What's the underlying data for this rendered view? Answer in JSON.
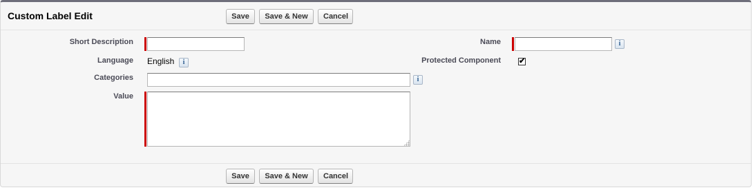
{
  "header": {
    "title": "Custom Label Edit",
    "buttons": {
      "save": "Save",
      "save_new": "Save & New",
      "cancel": "Cancel"
    }
  },
  "form": {
    "short_description": {
      "label": "Short Description",
      "value": "",
      "required": true
    },
    "name": {
      "label": "Name",
      "value": "",
      "required": true
    },
    "language": {
      "label": "Language",
      "value": "English"
    },
    "protected_component": {
      "label": "Protected Component",
      "checked": true,
      "check_glyph": "✔"
    },
    "categories": {
      "label": "Categories",
      "value": ""
    },
    "value": {
      "label": "Value",
      "value": "",
      "required": true
    },
    "info_glyph": "i"
  },
  "footer": {
    "buttons": {
      "save": "Save",
      "save_new": "Save & New",
      "cancel": "Cancel"
    }
  },
  "colors": {
    "required_bar": "#cc0000",
    "label_text": "#4a4a56",
    "header_border": "#6e6e7a"
  }
}
